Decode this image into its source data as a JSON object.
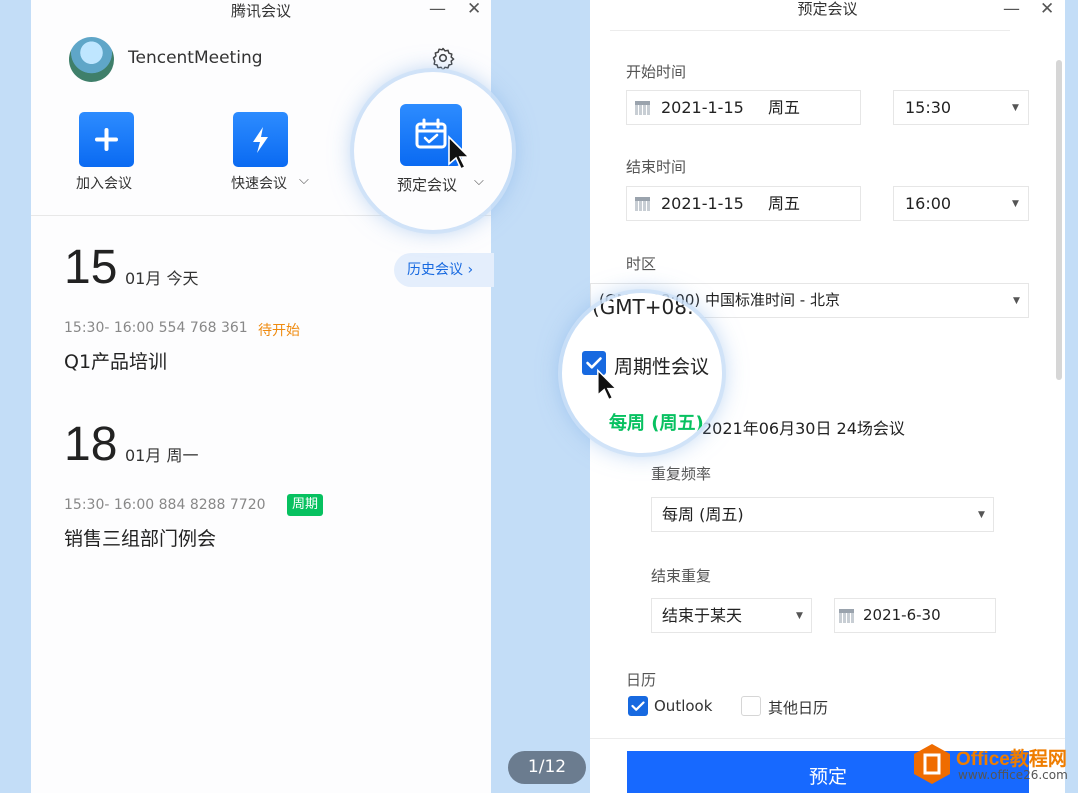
{
  "left_window": {
    "title": "腾讯会议",
    "minimize": "—",
    "close": "✕",
    "username": "TencentMeeting",
    "actions": {
      "join_label": "加入会议",
      "quick_label": "快速会议",
      "schedule_label": "预定会议",
      "chevron": "⌵"
    },
    "days": [
      {
        "day": "15",
        "sub": "01月  今天",
        "meeting": {
          "meta": "15:30- 16:00  554 768 361",
          "status": "待开始",
          "title": "Q1产品培训"
        }
      },
      {
        "day": "18",
        "sub": "01月  周一",
        "meeting": {
          "meta": "15:30- 16:00  884 8288 7720",
          "badge": "周期",
          "title": "销售三组部门例会"
        }
      }
    ],
    "history_button": "历史会议  ›"
  },
  "right_window": {
    "title": "预定会议",
    "minimize": "—",
    "close": "✕",
    "start": {
      "label": "开始时间",
      "date": "2021-1-15",
      "weekday": "周五",
      "time": "15:30"
    },
    "end": {
      "label": "结束时间",
      "date": "2021-1-15",
      "weekday": "周五",
      "time": "16:00"
    },
    "timezone": {
      "label": "时区",
      "value": "(GMT+08:00) 中国标准时间 - 北京",
      "magnified": "(GMT+08:00) 中国标准时间"
    },
    "recurring": {
      "label": "周期性会议",
      "checked": true,
      "summary_weekly": "每周 (周五)",
      "summary_rest": "2021年06月30日 24场会议"
    },
    "frequency": {
      "label": "重复频率",
      "value": "每周 (周五)"
    },
    "end_repeat": {
      "label": "结束重复",
      "mode": "结束于某天",
      "date": "2021-6-30"
    },
    "calendar": {
      "label": "日历",
      "outlook": "Outlook",
      "other": "其他日历"
    },
    "book_button": "预定",
    "caret": "▼"
  },
  "page_indicator": "1/12",
  "watermark": {
    "text": "Office教程网",
    "url": "www.office26.com"
  },
  "colors": {
    "accent": "#1769ff",
    "badge_green": "#07c160",
    "status_orange": "#ef8b10",
    "background": "#c3ddf7"
  }
}
